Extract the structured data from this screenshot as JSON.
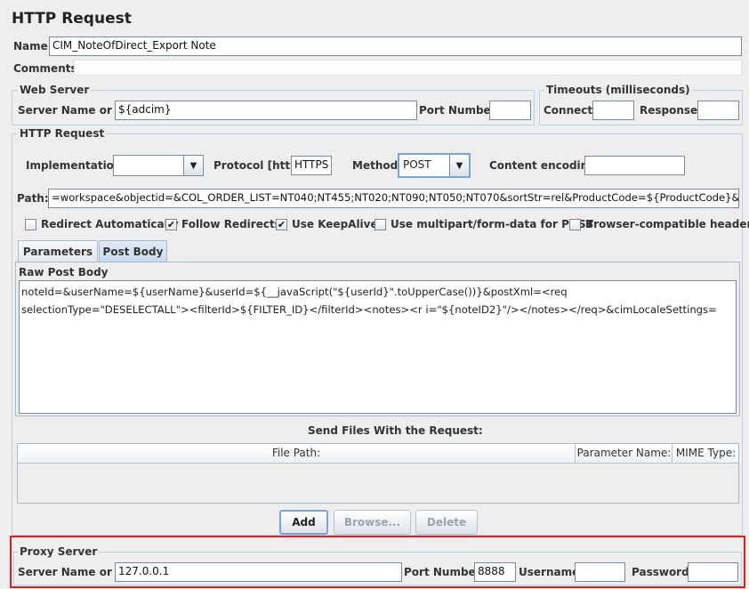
{
  "title": "HTTP Request",
  "name": {
    "label": "Name:",
    "value": "CIM_NoteOfDirect_Export Note"
  },
  "comments": {
    "label": "Comments:"
  },
  "web_server": {
    "legend": "Web Server",
    "server_label": "Server Name or IP:",
    "server_value": "${adcim}",
    "port_label": "Port Number:",
    "port_value": ""
  },
  "timeouts": {
    "legend": "Timeouts (milliseconds)",
    "connect_label": "Connect:",
    "response_label": "Response:"
  },
  "http_request": {
    "legend": "HTTP Request",
    "implementation_label": "Implementation:",
    "implementation_value": "",
    "protocol_label": "Protocol [http]:",
    "protocol_value": "HTTPS",
    "method_label": "Method:",
    "method_value": "POST",
    "encoding_label": "Content encoding:",
    "encoding_value": "",
    "path_label": "Path:",
    "path_value": "=workspace&objectid=&COL_ORDER_LIST=NT040;NT455;NT020;NT090;NT050;NT070&sortStr=rel&ProductCode=${ProductCode}&Locale="
  },
  "options": [
    {
      "label": "Redirect Automatically",
      "checked": false
    },
    {
      "label": "Follow Redirects",
      "checked": true
    },
    {
      "label": "Use KeepAlive",
      "checked": true
    },
    {
      "label": "Use multipart/form-data for POST",
      "checked": false
    },
    {
      "label": "Browser-compatible headers",
      "checked": false
    }
  ],
  "tabs": [
    {
      "label": "Parameters",
      "active": false
    },
    {
      "label": "Post Body",
      "active": true
    }
  ],
  "raw_post_body": {
    "label": "Raw Post Body",
    "line1": "noteId=&userName=${userName}&userId=${__javaScript(\"${userId}\".toUpperCase())}&postXml=<req",
    "line2": "selectionType=\"DESELECTALL\"><filterId>${FILTER_ID}</filterId><notes><r i=\"${noteID2}\"/></notes></req>&cimLocaleSettings="
  },
  "send_files": {
    "title": "Send Files With the Request:",
    "columns": [
      "File Path:",
      "Parameter Name:",
      "MIME Type:"
    ]
  },
  "buttons": {
    "add": "Add",
    "browse": "Browse...",
    "delete": "Delete"
  },
  "proxy": {
    "legend": "Proxy Server",
    "server_label": "Server Name or IP:",
    "server_value": "127.0.0.1",
    "port_label": "Port Number:",
    "port_value": "8888",
    "username_label": "Username",
    "username_value": "",
    "password_label": "Password",
    "password_value": ""
  },
  "check_glyph": "✔",
  "dropdown_glyph": "▼",
  "highlight_color": "#e02020"
}
